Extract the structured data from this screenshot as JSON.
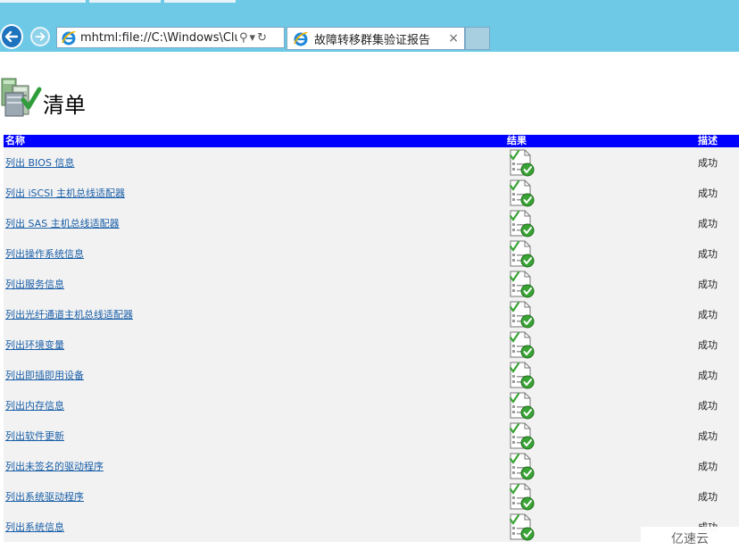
{
  "browser": {
    "address_url": "mhtml:file://C:\\Windows\\Cluste",
    "tab_title": "故障转移群集验证报告",
    "search_glyph": "⚲",
    "dropdown_glyph": "▾",
    "refresh_glyph": "↻",
    "close_glyph": "×"
  },
  "page": {
    "heading": "清单"
  },
  "table": {
    "headers": {
      "name": "名称",
      "result": "结果",
      "desc": "描述"
    },
    "rows": [
      {
        "name": "列出 BIOS 信息",
        "desc": "成功"
      },
      {
        "name": "列出 iSCSI 主机总线适配器",
        "desc": "成功"
      },
      {
        "name": "列出 SAS 主机总线适配器",
        "desc": "成功"
      },
      {
        "name": "列出操作系统信息",
        "desc": "成功"
      },
      {
        "name": "列出服务信息",
        "desc": "成功"
      },
      {
        "name": "列出光纤通道主机总线适配器",
        "desc": "成功"
      },
      {
        "name": "列出环境变量",
        "desc": "成功"
      },
      {
        "name": "列出即插即用设备",
        "desc": "成功"
      },
      {
        "name": "列出内存信息",
        "desc": "成功"
      },
      {
        "name": "列出软件更新",
        "desc": "成功"
      },
      {
        "name": "列出未签名的驱动程序",
        "desc": "成功"
      },
      {
        "name": "列出系统驱动程序",
        "desc": "成功"
      },
      {
        "name": "列出系统信息",
        "desc": "成功"
      }
    ]
  },
  "watermark": "亿速云",
  "colors": {
    "chrome": "#6dc9e6",
    "header_bar": "#0000ff",
    "link": "#1a5fa8",
    "success": "#3aa335"
  }
}
